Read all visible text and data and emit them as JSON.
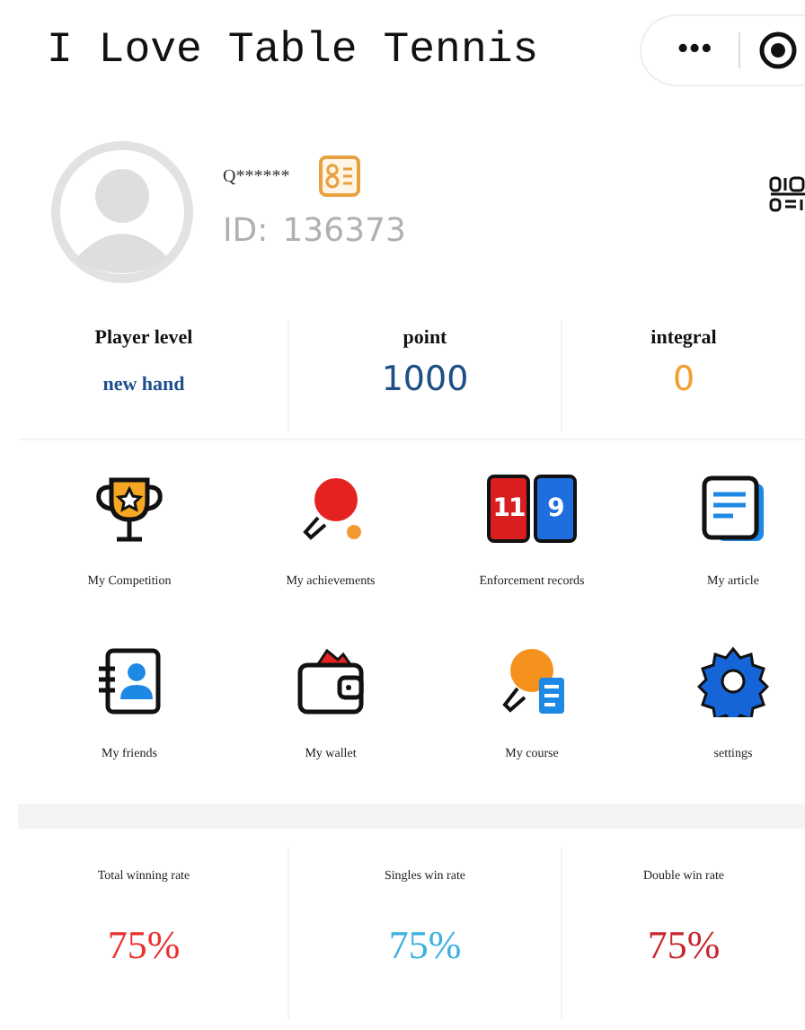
{
  "header": {
    "title": "I Love Table Tennis",
    "capsule_more": "•••"
  },
  "profile": {
    "name": "Q******",
    "id_label": "ID:",
    "id": "136373"
  },
  "stats": [
    {
      "label": "Player level",
      "value": "new hand",
      "kind": "small",
      "color": "#1f4e8c"
    },
    {
      "label": "point",
      "value": "1000",
      "kind": "big",
      "color": "#1d4f86"
    },
    {
      "label": "integral",
      "value": "0",
      "kind": "big",
      "color": "#f0a030"
    }
  ],
  "menu": [
    {
      "label": "My Competition",
      "kind": "trophy"
    },
    {
      "label": "My achievements",
      "kind": "paddle"
    },
    {
      "label": "Enforcement records",
      "kind": "scoreboard",
      "digits": [
        "11",
        "9"
      ]
    },
    {
      "label": "My article",
      "kind": "article"
    },
    {
      "label": "My friends",
      "kind": "contacts"
    },
    {
      "label": "My wallet",
      "kind": "wallet"
    },
    {
      "label": "My course",
      "kind": "course"
    },
    {
      "label": "settings",
      "kind": "gear"
    }
  ],
  "rates": [
    {
      "label": "Total winning rate",
      "value": "75%",
      "color": "#e8302e"
    },
    {
      "label": "Singles win rate",
      "value": "75%",
      "color": "#3ab0e0"
    },
    {
      "label": "Double win rate",
      "value": "75%",
      "color": "#c8262c"
    }
  ]
}
